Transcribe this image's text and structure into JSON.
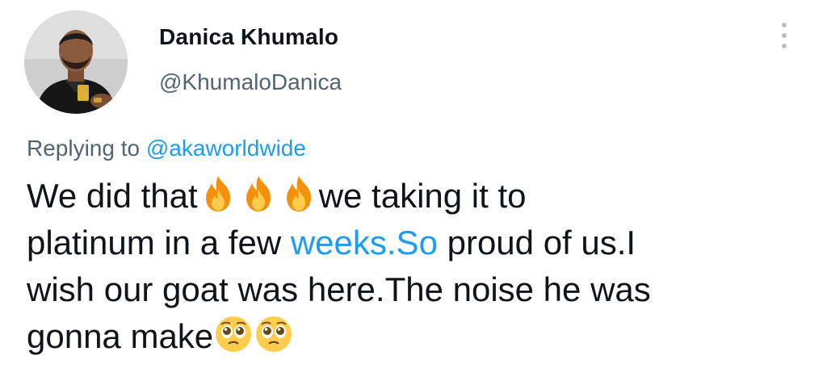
{
  "author": {
    "display_name": "Danica Khumalo",
    "handle": "@KhumaloDanica"
  },
  "reply_context": {
    "prefix": "Replying to ",
    "mention": "@akaworldwide"
  },
  "tweet": {
    "line1_a": "We did that",
    "line1_b": "we taking it to",
    "line2_a": "platinum in a few ",
    "line2_link": "weeks.So",
    "line2_b": " proud of us.I",
    "line3": "wish our goat was here.The noise he was",
    "line4": "gonna make"
  },
  "icons": {
    "more": "more-options-icon",
    "fire_emoji": "fire-emoji",
    "pleading_emoji": "pleading-face-emoji"
  },
  "colors": {
    "text": "#0f1419",
    "secondary": "#536471",
    "link": "#1d9bf0"
  }
}
